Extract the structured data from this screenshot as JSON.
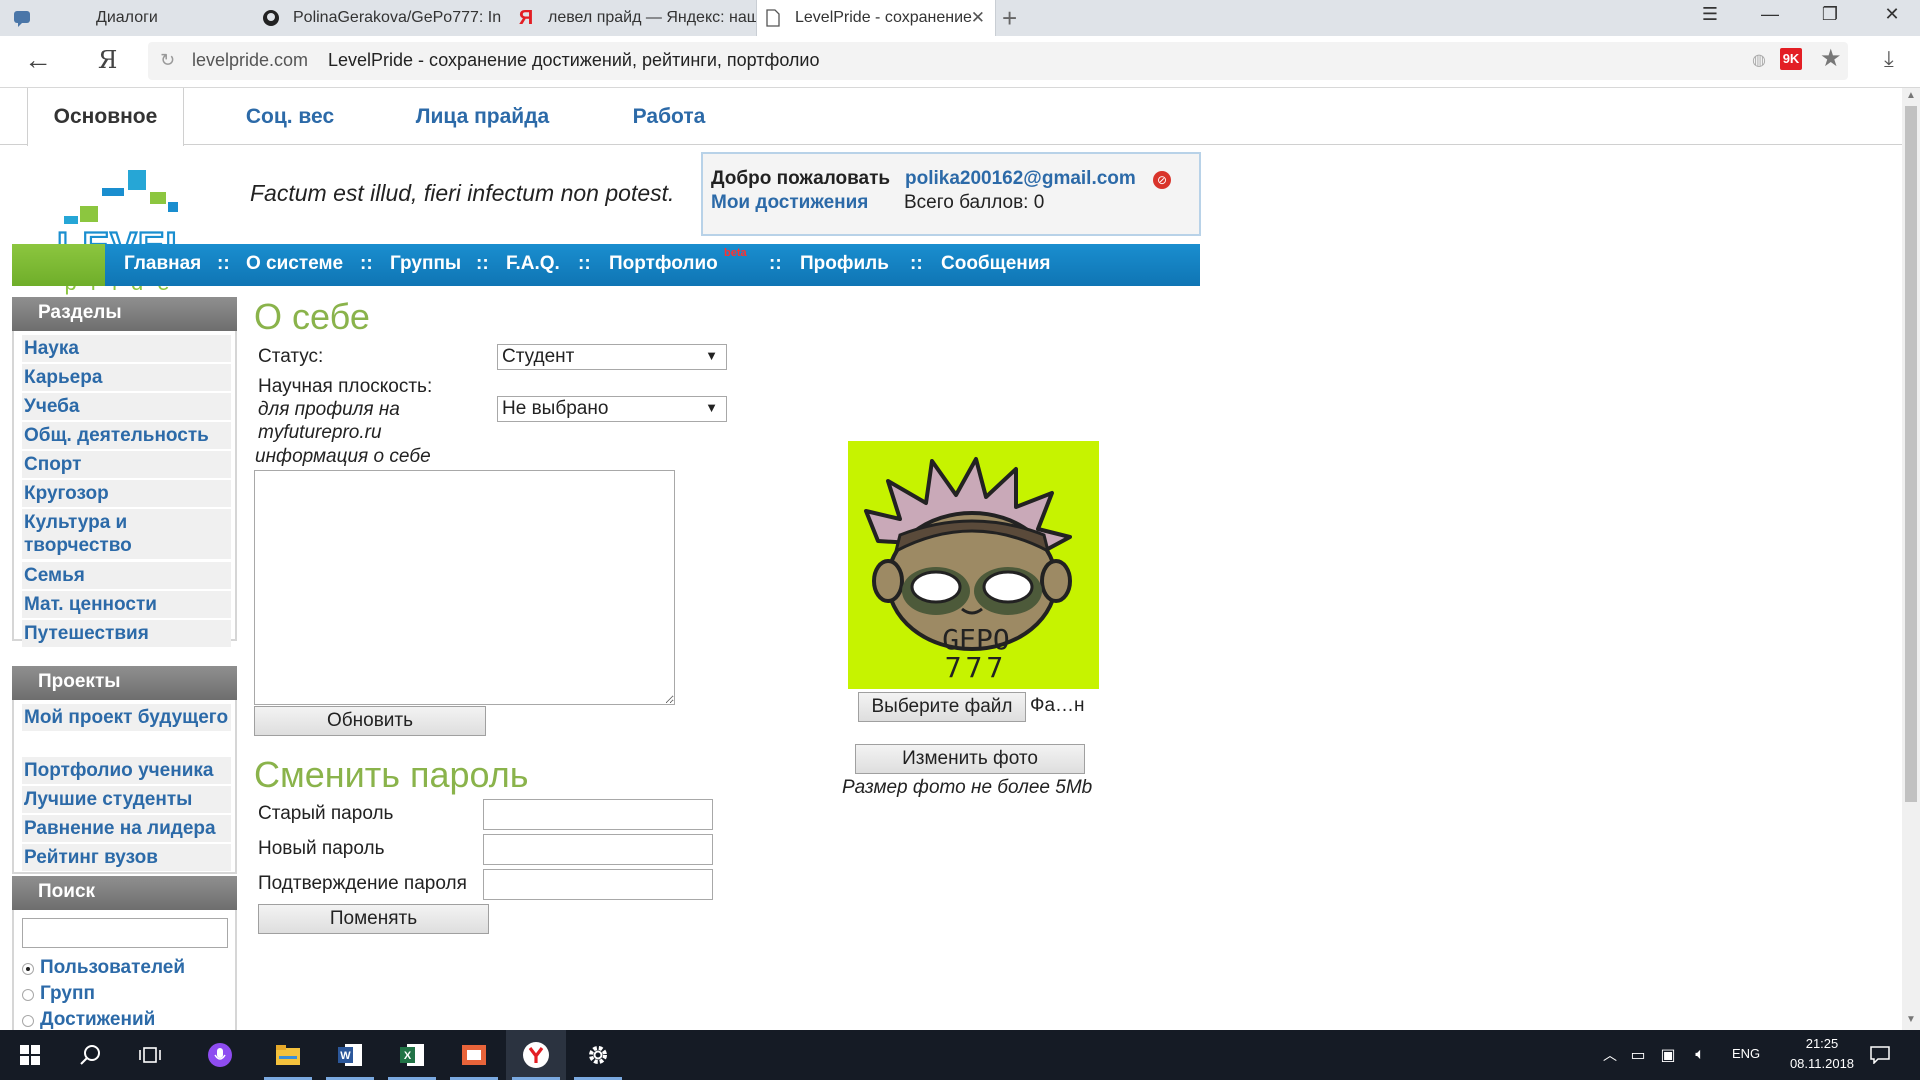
{
  "browser": {
    "tabs": [
      {
        "title": "Диалоги"
      },
      {
        "title": "PolinaGerakova/GePo777: In"
      },
      {
        "title": "левел прайд — Яндекс: нашл"
      },
      {
        "title": "LevelPride - сохранение д"
      }
    ],
    "yandex_button": "Я",
    "url_domain": "levelpride.com",
    "url_title": "LevelPride - сохранение достижений, рейтинги, портфолио",
    "extension_label": "9K"
  },
  "site": {
    "top_tabs": [
      "Основное",
      "Соц. вес",
      "Лица прайда",
      "Работа"
    ],
    "logo": {
      "word": "LEVEL",
      "sub": "pride"
    },
    "motto": "Factum est illud, fieri infectum non potest.",
    "welcome": {
      "label": "Добро пожаловать",
      "email": "polika200162@gmail.com",
      "achievements": "Мои достижения",
      "total": "Всего баллов: 0"
    },
    "nav": {
      "items": [
        "Главная",
        "О системе",
        "Группы",
        "F.A.Q.",
        "Портфолио",
        "Профиль",
        "Сообщения"
      ],
      "separator": "::",
      "beta": "beta"
    }
  },
  "sidebar": {
    "sections_title": "Разделы",
    "sections": [
      "Наука",
      "Карьера",
      "Учеба",
      "Общ. деятельность",
      "Спорт",
      "Кругозор",
      "Культура и творчество",
      "Семья",
      "Мат. ценности",
      "Путешествия"
    ],
    "projects_title": "Проекты",
    "projects": [
      "Мой проект будущего",
      "Портфолио ученика",
      "Лучшие студенты",
      "Равнение на лидера",
      "Рейтинг вузов"
    ],
    "search_title": "Поиск",
    "search_value": "",
    "search_options": [
      "Пользователей",
      "Групп",
      "Достижений"
    ],
    "search_selected": "Пользователей"
  },
  "about": {
    "title": "О себе",
    "status_label": "Статус:",
    "status_value": "Студент",
    "science_label": "Научная плоскость:",
    "profile_note": "для профиля на myfuturepro.ru",
    "science_value": "Не выбрано",
    "info_label": "информация о себе",
    "info_value": "",
    "update_button": "Обновить"
  },
  "photo": {
    "caption_line1": "GEPO",
    "caption_line2": "777",
    "choose_file": "Выберите файл",
    "file_name": "Фа…н",
    "change_button": "Изменить фото",
    "note": "Размер фото не более 5Mb"
  },
  "password": {
    "title": "Сменить пароль",
    "old_label": "Старый пароль",
    "new_label": "Новый пароль",
    "confirm_label": "Подтверждение пароля",
    "submit": "Поменять"
  },
  "taskbar": {
    "lang": "ENG",
    "time": "21:25",
    "date": "08.11.2018"
  },
  "colors": {
    "link": "#2c6aa8",
    "section_title": "#8ab34b",
    "nav_blue": "#0f75b4",
    "nav_green": "#8cc63f",
    "avatar_bg": "#c6f300"
  }
}
